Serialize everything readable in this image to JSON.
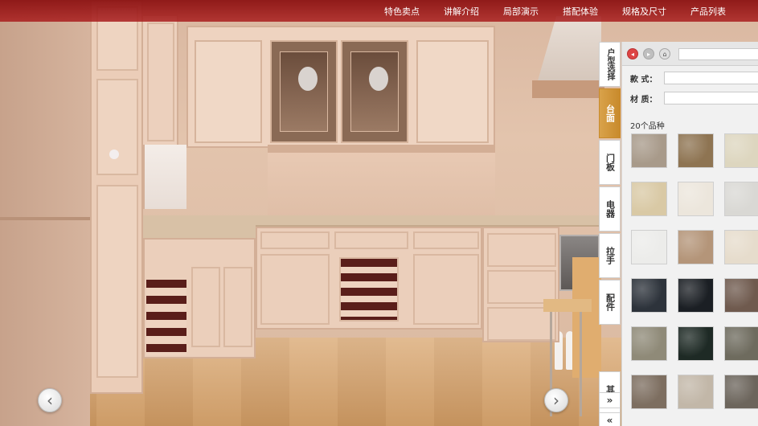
{
  "nav": {
    "items": [
      "特色卖点",
      "讲解介绍",
      "局部演示",
      "搭配体验",
      "规格及尺寸",
      "产品列表"
    ]
  },
  "side_tabs": {
    "house_type": "户型选择",
    "countertop": "台面",
    "door_panel": "门板",
    "appliance": "电器",
    "handle": "拉手",
    "accessory": "配件",
    "other": "其他",
    "expand": "»",
    "collapse": "«",
    "active": "countertop"
  },
  "panel": {
    "back_icon": "◂",
    "forward_icon": "▸",
    "home_icon": "⌂",
    "style_label": "款  式：",
    "material_label": "材  质：",
    "count_text": "20个品种",
    "swatch_colors": [
      "#a89a8a",
      "#8e7452",
      "#ddd6bf",
      "#d9c9a5",
      "#ece6dc",
      "#d9d8d4",
      "#ececea",
      "#b49579",
      "#e6dccc",
      "#2d333b",
      "#1b1f24",
      "#6f5a4e",
      "#8f8a78",
      "#1e2a25",
      "#6e6b5e",
      "#7d6e60",
      "#c2b7a8",
      "#6c655c"
    ]
  },
  "arrows": {
    "prev": "‹",
    "next": "›"
  },
  "colors": {
    "nav_bg": "#8c1212",
    "active_tab": "#d9a24a"
  }
}
